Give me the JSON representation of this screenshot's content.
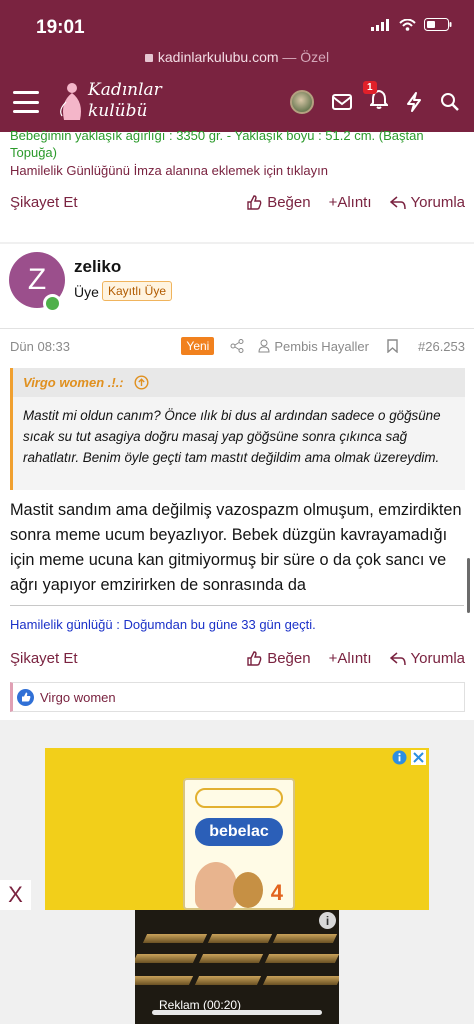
{
  "status_bar": {
    "time": "19:01"
  },
  "browser": {
    "domain": "kadinlarkulubu.com",
    "mode": "— Özel"
  },
  "header": {
    "logo_text": "Kadınlar\nkulübü",
    "notification_count": "1"
  },
  "post_prev": {
    "signature_baby": "Bebeğimin yaklaşık ağırlığı : 3350 gr. - Yaklaşık boyu : 51.2 cm. (Baştan Topuğa)",
    "signature_link": "Hamilelik Günlüğünü İmza alanına eklemek için tıklayın",
    "actions": {
      "report": "Şikayet Et",
      "like": "Beğen",
      "quote": "+Alıntı",
      "reply": "Yorumla"
    }
  },
  "post": {
    "avatar_letter": "Z",
    "username": "zeliko",
    "role": "Üye",
    "tag": "Kayıtlı Üye",
    "date": "Dün 08:33",
    "new_badge": "Yeni",
    "thread_owner": "Pembis Hayaller",
    "post_number": "#26.253",
    "quote": {
      "author": "Virgo women .!.:",
      "text": "Mastit mi oldun canım? Önce ılık bi dus al ardından sadece o göğsüne sıcak su tut asagiya doğru masaj yap göğsüne sonra çıkınca sağ rahatlatır. Benim öyle geçti tam mastıt değildim ama olmak üzereydim."
    },
    "message": "Mastit sandım ama değilmiş vazospazm olmuşum, emzirdikten sonra meme ucum beyazlıyor. Bebek düzgün kavrayamadığı için meme ucuna kan gitmiyormuş bir süre o da çok sancı ve ağrı yapıyor emzirirken de sonrasında da",
    "signature": "Hamilelik günlüğü : Doğumdan bu güne 33 gün geçti.",
    "actions": {
      "report": "Şikayet Et",
      "like": "Beğen",
      "quote": "+Alıntı",
      "reply": "Yorumla"
    },
    "reaction_user": "Virgo women"
  },
  "ad": {
    "brand": "bebelac",
    "stage": "4",
    "video_label": "Reklam (00:20)",
    "close_x": "X"
  },
  "colors": {
    "primary": "#7a2340",
    "link_green": "#2b9a2b",
    "link_blue": "#1b31c8",
    "quote_accent": "#f0a030"
  }
}
